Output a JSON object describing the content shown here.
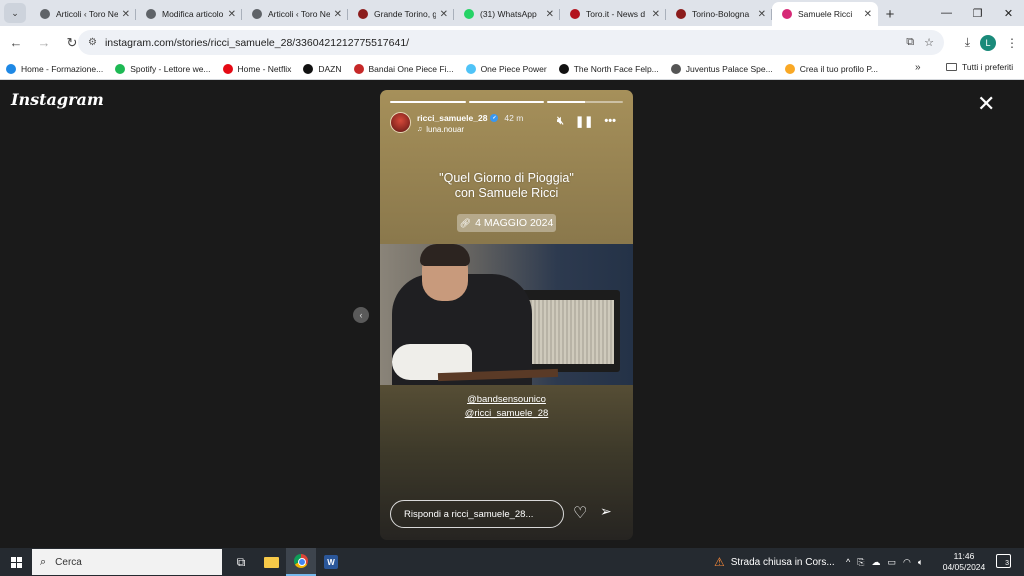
{
  "browser": {
    "tabs": [
      {
        "title": "Articoli ‹ Toro News",
        "favicon_color": "#5f6368",
        "favicon": "globe-icon"
      },
      {
        "title": "Modifica articolo",
        "favicon_color": "#5f6368",
        "favicon": "globe-icon"
      },
      {
        "title": "Articoli ‹ Toro News",
        "favicon_color": "#5f6368",
        "favicon": "globe-icon"
      },
      {
        "title": "Grande Torino, g",
        "favicon_color": "#8b1c1c",
        "favicon": "toro-icon"
      },
      {
        "title": "(31) WhatsApp",
        "favicon_color": "#25d366",
        "favicon": "whatsapp-icon"
      },
      {
        "title": "Toro.it - News d",
        "favicon_color": "#b3121d",
        "favicon": "toro-it-icon"
      },
      {
        "title": "Torino-Bologna",
        "favicon_color": "#8b1c1c",
        "favicon": "toro-icon"
      },
      {
        "title": "Samuele Ricci",
        "favicon_color": "#d62976",
        "favicon": "instagram-icon",
        "active": true
      }
    ],
    "new_tab": "+",
    "url": "instagram.com/stories/ricci_samuele_28/3360421212775517641/",
    "bookmarks": [
      {
        "label": "Home - Formazione...",
        "color": "#1e88e5",
        "icon": "formazione-icon"
      },
      {
        "label": "Spotify - Lettore we...",
        "color": "#1db954",
        "icon": "spotify-icon"
      },
      {
        "label": "Home - Netflix",
        "color": "#e50914",
        "icon": "netflix-icon"
      },
      {
        "label": "DAZN",
        "color": "#111111",
        "icon": "dazn-icon"
      },
      {
        "label": "Bandai One Piece Fi...",
        "color": "#c62828",
        "icon": "bandai-icon"
      },
      {
        "label": "One Piece Power",
        "color": "#4fc3f7",
        "icon": "onepiece-icon"
      },
      {
        "label": "The North Face Felp...",
        "color": "#111111",
        "icon": "northface-icon"
      },
      {
        "label": "Juventus Palace Spe...",
        "color": "#555555",
        "icon": "globe-icon"
      },
      {
        "label": "Crea il tuo profilo P...",
        "color": "#f9a825",
        "icon": "profile-icon"
      }
    ],
    "bookmarks_more": "»",
    "bookmarks_folder": "Tutti i preferiti",
    "profile_initial": "L"
  },
  "instagram": {
    "logo": "Instagram",
    "story": {
      "username": "ricci_samuele_28",
      "time": "42 m",
      "music": "luna.nouar",
      "quote_line1": "\"Quel Giorno di Pioggia\"",
      "quote_line2": "con Samuele Ricci",
      "date_chip": "4 MAGGIO 2024",
      "mention1": "@bandsensounico",
      "mention2": "@ricci_samuele_28",
      "reply_placeholder": "Rispondi a ricci_samuele_28..."
    }
  },
  "taskbar": {
    "search_placeholder": "Cerca",
    "notification": "Strada chiusa in Cors...",
    "time": "11:46",
    "date": "04/05/2024",
    "notif_count": "3"
  }
}
